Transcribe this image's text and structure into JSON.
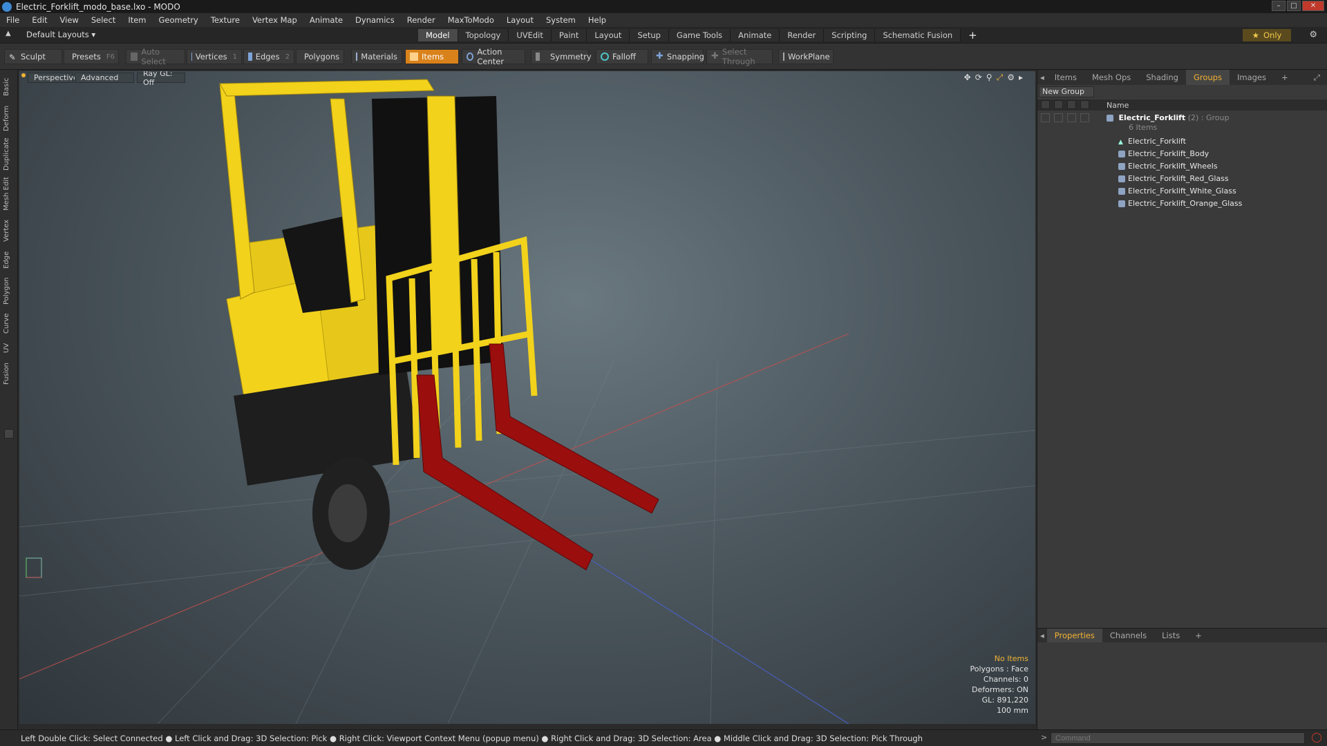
{
  "window": {
    "title": "Electric_Forklift_modo_base.lxo - MODO"
  },
  "menu": [
    "File",
    "Edit",
    "View",
    "Select",
    "Item",
    "Geometry",
    "Texture",
    "Vertex Map",
    "Animate",
    "Dynamics",
    "Render",
    "MaxToModo",
    "Layout",
    "System",
    "Help"
  ],
  "layouts": {
    "default_label": "Default Layouts",
    "tabs": [
      "Model",
      "Topology",
      "UVEdit",
      "Paint",
      "Layout",
      "Setup",
      "Game Tools",
      "Animate",
      "Render",
      "Scripting",
      "Schematic Fusion"
    ],
    "active_tab": "Model",
    "plus": "+",
    "only_label": "Only"
  },
  "toolbar": {
    "sculpt": "Sculpt",
    "presets": "Presets",
    "presets_key": "F6",
    "auto_select": "Auto Select",
    "vertices": "Vertices",
    "vertices_key": "1",
    "edges": "Edges",
    "edges_key": "2",
    "polygons": "Polygons",
    "materials": "Materials",
    "items": "Items",
    "action_center": "Action Center",
    "symmetry": "Symmetry",
    "falloff": "Falloff",
    "snapping": "Snapping",
    "select_through": "Select Through",
    "workplane": "WorkPlane"
  },
  "left_tabs": [
    "Basic",
    "Deform",
    "Duplicate",
    "Mesh Edit",
    "Vertex",
    "Edge",
    "Polygon",
    "Curve",
    "UV",
    "Fusion"
  ],
  "viewport": {
    "view": "Perspective",
    "advanced": "Advanced",
    "raygl": "Ray GL: Off",
    "hud": {
      "no_items": "No Items",
      "polygons": "Polygons : Face",
      "channels": "Channels: 0",
      "deformers": "Deformers: ON",
      "gl": "GL: 891,220",
      "scale": "100 mm"
    }
  },
  "right_panel": {
    "tabs": [
      "Items",
      "Mesh Ops",
      "Shading",
      "Groups",
      "Images",
      "+"
    ],
    "active_tab": "Groups",
    "new_group": "New Group",
    "column_name": "Name",
    "group": {
      "name": "Electric_Forklift",
      "count": "(2)",
      "type": ": Group",
      "subtitle": "6 Items"
    },
    "items": [
      "Electric_Forklift",
      "Electric_Forklift_Body",
      "Electric_Forklift_Wheels",
      "Electric_Forklift_Red_Glass",
      "Electric_Forklift_White_Glass",
      "Electric_Forklift_Orange_Glass"
    ]
  },
  "properties": {
    "tabs": [
      "Properties",
      "Channels",
      "Lists",
      "+"
    ],
    "active_tab": "Properties"
  },
  "status": "Left Double Click: Select Connected ● Left Click and Drag: 3D Selection: Pick ● Right Click: Viewport Context Menu (popup menu) ● Right Click and Drag: 3D Selection: Area ● Middle Click and Drag: 3D Selection: Pick Through",
  "command": {
    "placeholder": "Command"
  },
  "colors": {
    "accent": "#f2b233",
    "items_active": "#d9821b",
    "forklift_yellow": "#f2d21b",
    "fork_red": "#9b0e0e"
  }
}
